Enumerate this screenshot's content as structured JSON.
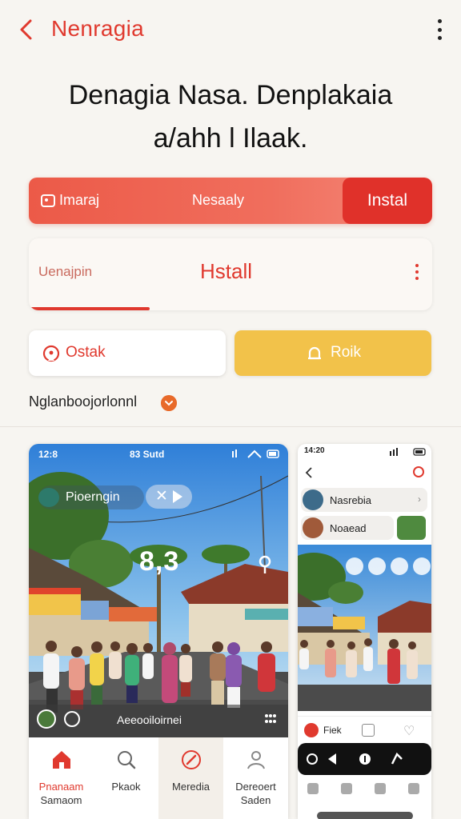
{
  "header": {
    "title": "Nenragia",
    "accent_color": "#e0392e"
  },
  "headline": {
    "line1": "Denagia Nasa. Denplakaia",
    "line2": "a/ahh l Ilaak."
  },
  "install_bar": {
    "icon": "image-icon",
    "label_left": "Imaraj",
    "label_middle": "Nesaaly",
    "install_label": "Instal"
  },
  "install_card": {
    "subtitle": "Uenajpin",
    "install_label": "Hstall",
    "progress_percent": 30
  },
  "actions": {
    "left": {
      "icon": "location-icon",
      "label": "Ostak"
    },
    "right": {
      "icon": "bell-icon",
      "label": "Roik",
      "color": "#f2c24a"
    }
  },
  "tagline": {
    "text": "Nglanboojorlonnl"
  },
  "screenshot1": {
    "status_time": "12:8",
    "status_mid": "83 Sutd",
    "chip_name": "Pioerngin",
    "chip_close": "✕",
    "big_stat": "8,3",
    "footer_label": "Aeeooiloirnei",
    "nav": [
      {
        "icon": "home-icon",
        "label1": "Pnanaam",
        "label2": "Samaom",
        "active": true
      },
      {
        "icon": "search-icon",
        "label1": "Pkaok",
        "label2": ""
      },
      {
        "icon": "compass-icon",
        "label1": "Meredia",
        "label2": ""
      },
      {
        "icon": "user-icon",
        "label1": "Dereoert",
        "label2": "Saden"
      }
    ]
  },
  "screenshot2": {
    "status_time": "14:20",
    "row1_name": "Nasrebia",
    "row2_name": "Noaead",
    "bottom_label": "Fiek"
  }
}
